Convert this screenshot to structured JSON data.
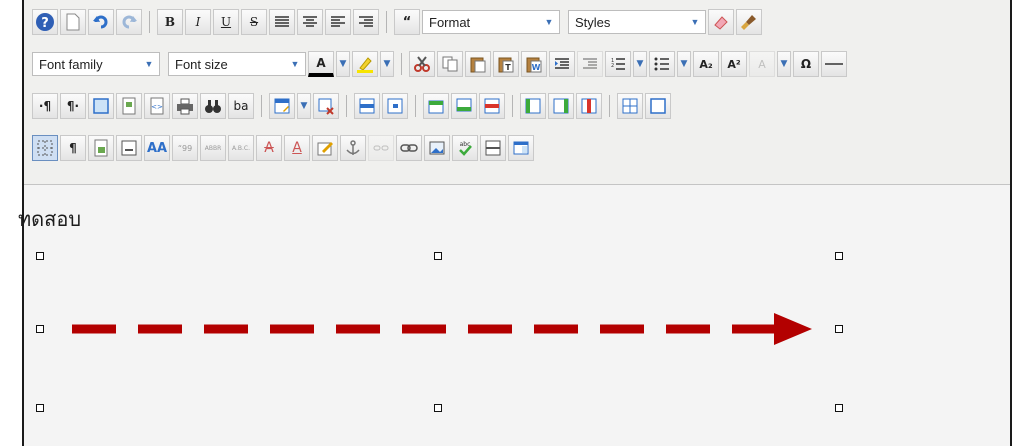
{
  "toolbar": {
    "row1": {
      "buttons": [
        "help-icon",
        "new-document-icon",
        "undo-icon",
        "redo-icon",
        "bold-icon",
        "italic-icon",
        "underline-icon",
        "strikethrough-icon",
        "align-left-icon",
        "align-center-icon",
        "align-right-icon",
        "align-justify-icon",
        "blockquote-icon",
        "eraser-icon",
        "brush-icon"
      ],
      "bold_label": "B",
      "italic_label": "I",
      "underline_label": "U",
      "strike_label": "S",
      "format_label": "Format",
      "styles_label": "Styles"
    },
    "row2": {
      "font_family_label": "Font family",
      "font_size_label": "Font size",
      "font_color_label": "A",
      "subscript_label": "A₂",
      "superscript_label": "A²",
      "omega_label": "Ω"
    },
    "row3": {
      "ltr_label": "·¶",
      "rtl_label": "¶·",
      "abbr_label": "ba"
    },
    "row4": {
      "pilcrow_label": "¶",
      "styleprops_label": "AA",
      "cite_label": "“99",
      "abbr_label": "ABBR",
      "acronym_label": "A.B.C.",
      "del_label": "A",
      "ins_label": "A"
    }
  },
  "editor": {
    "content_text": "ทดสอบ"
  },
  "colors": {
    "arrow": "#b30000",
    "toolbar_bg": "#f0f0ee",
    "accent_blue": "#2e6fc9"
  }
}
